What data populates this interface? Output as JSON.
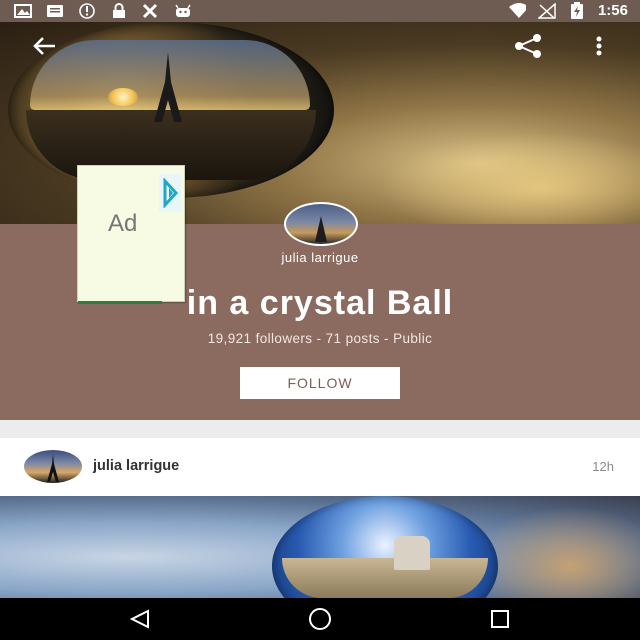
{
  "status_bar": {
    "time": "1:56",
    "left_icons": [
      "image-icon",
      "message-icon",
      "info-icon",
      "lock-icon",
      "tools-icon",
      "android-icon"
    ],
    "right_icons": [
      "wifi-icon",
      "signal-off-icon",
      "battery-charging-icon"
    ]
  },
  "toolbar": {
    "back_icon": "arrow-back-icon",
    "share_icon": "share-icon",
    "menu_icon": "more-vert-icon"
  },
  "ad": {
    "label": "Ad"
  },
  "collection": {
    "owner": "julia larrigue",
    "title": "in a crystal Ball",
    "stats": "19,921 followers - 71 posts - Public",
    "follow_label": "FOLLOW"
  },
  "post": {
    "author": "julia larrigue",
    "time": "12h"
  },
  "nav": {
    "back_icon": "nav-back-icon",
    "home_icon": "nav-home-icon",
    "recents_icon": "nav-recents-icon"
  },
  "colors": {
    "status_bar": "#6e5b52",
    "profile_band": "#8b6b5f",
    "follow_text": "#7b5f55"
  }
}
